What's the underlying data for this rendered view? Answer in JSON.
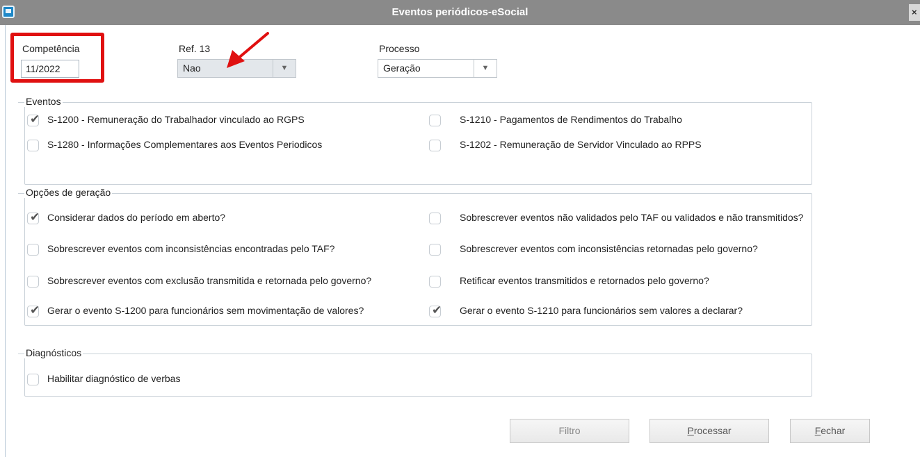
{
  "window": {
    "title": "Eventos periódicos-eSocial",
    "close_glyph": "×"
  },
  "competencia": {
    "label": "Competência",
    "value": "11/2022"
  },
  "ref13": {
    "label": "Ref. 13",
    "value": "Nao"
  },
  "processo": {
    "label": "Processo",
    "value": "Geração"
  },
  "eventos": {
    "title": "Eventos",
    "items": [
      {
        "label": "S-1200 - Remuneração do Trabalhador vinculado ao RGPS",
        "checked": true
      },
      {
        "label": "S-1210 - Pagamentos de Rendimentos do Trabalho",
        "checked": false
      },
      {
        "label": "S-1280 - Informações Complementares aos Eventos Periodicos",
        "checked": false
      },
      {
        "label": "S-1202 - Remuneração de Servidor Vinculado ao RPPS",
        "checked": false
      }
    ]
  },
  "opcoes": {
    "title": "Opções de geração",
    "items": [
      {
        "label": "Considerar dados do período em aberto?",
        "checked": true
      },
      {
        "label": "Sobrescrever eventos não validados pelo TAF ou validados e não transmitidos?",
        "checked": false
      },
      {
        "label": "Sobrescrever eventos com inconsistências encontradas pelo TAF?",
        "checked": false
      },
      {
        "label": "Sobrescrever eventos com inconsistências retornadas pelo governo?",
        "checked": false
      },
      {
        "label": "Sobrescrever eventos com exclusão transmitida e retornada pelo governo?",
        "checked": false
      },
      {
        "label": "Retificar eventos transmitidos e retornados pelo governo?",
        "checked": false
      },
      {
        "label": "Gerar o evento S-1200 para funcionários sem movimentação de valores?",
        "checked": true
      },
      {
        "label": "Gerar o evento S-1210 para funcionários sem valores a declarar?",
        "checked": true
      }
    ]
  },
  "diagnosticos": {
    "title": "Diagnósticos",
    "items": [
      {
        "label": "Habilitar diagnóstico de verbas",
        "checked": false
      }
    ]
  },
  "buttons": {
    "filtro": "Filtro",
    "processar_first": "P",
    "processar_rest": "rocessar",
    "fechar_first": "F",
    "fechar_rest": "echar"
  },
  "colors": {
    "titlebar": "#8a8a8a",
    "highlight": "#e01010",
    "app_icon": "#1e88c8"
  },
  "check_glyph": "✔"
}
